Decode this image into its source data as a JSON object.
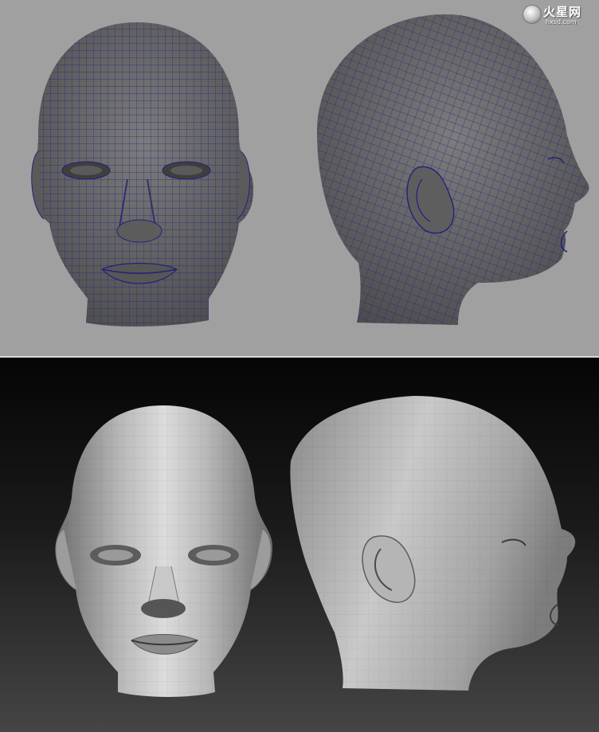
{
  "watermark": {
    "brand": "火星网",
    "domain": "hxsd.com"
  },
  "colors": {
    "top_background": "#a0a0a0",
    "wire_color": "#2a2a8c",
    "mesh_fill": "#6a6a6a",
    "bottom_background": "#1a1a1a"
  },
  "icons": {
    "logo": "hxsd-logo-icon"
  }
}
